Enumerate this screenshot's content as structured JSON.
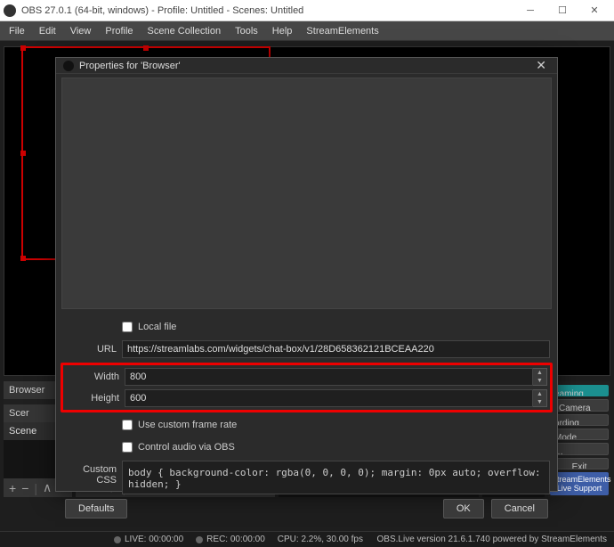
{
  "titlebar": {
    "title": "OBS 27.0.1 (64-bit, windows) - Profile: Untitled - Scenes: Untitled"
  },
  "menubar": {
    "items": [
      "File",
      "Edit",
      "View",
      "Profile",
      "Scene Collection",
      "Tools",
      "Help",
      "StreamElements"
    ]
  },
  "docks": {
    "sources_label": "Browser",
    "scenes_head": "Scer",
    "scenes_item": "Scene"
  },
  "controls": {
    "stream": "eaming",
    "camera": "l Camera",
    "record": "ording",
    "mode": "Mode",
    "exit": "Exit",
    "support": "StreamElements Live Support"
  },
  "status": {
    "live": "LIVE: 00:00:00",
    "rec": "REC: 00:00:00",
    "cpu": "CPU: 2.2%, 30.00 fps",
    "version": "OBS.Live version 21.6.1.740 powered by StreamElements"
  },
  "dialog": {
    "title": "Properties for 'Browser'",
    "local_file": "Local file",
    "url_label": "URL",
    "url_value": "https://streamlabs.com/widgets/chat-box/v1/28D658362121BCEAA220",
    "width_label": "Width",
    "width_value": "800",
    "height_label": "Height",
    "height_value": "600",
    "use_custom_framerate": "Use custom frame rate",
    "control_audio": "Control audio via OBS",
    "css_label": "Custom CSS",
    "css_value": "body { background-color: rgba(0, 0, 0, 0); margin: 0px auto; overflow: hidden; }",
    "defaults": "Defaults",
    "ok": "OK",
    "cancel": "Cancel"
  }
}
